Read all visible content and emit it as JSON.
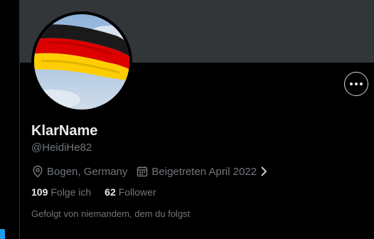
{
  "profile": {
    "display_name": "KlarName",
    "handle": "@HeidiHe82",
    "location": "Bogen, Germany",
    "joined": "Beigetreten April 2022",
    "following_count": "109",
    "following_label": "Folge ich",
    "followers_count": "62",
    "followers_label": "Follower",
    "followed_by_text": "Gefolgt von niemandem, dem du folgst"
  },
  "icons": {
    "more": "more-horizontal-icon",
    "location": "location-pin-icon",
    "calendar": "calendar-icon",
    "chevron": "chevron-right-icon"
  },
  "colors": {
    "background": "#000000",
    "banner": "#333639",
    "primary_text": "#e7e9ea",
    "secondary_text": "#71767b",
    "accent": "#1d9bf0",
    "flag_black": "#1a1a1a",
    "flag_red": "#dd0000",
    "flag_gold": "#ffce00"
  }
}
